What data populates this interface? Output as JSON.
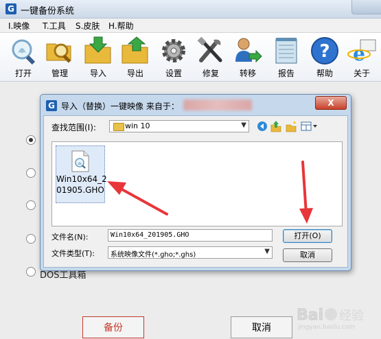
{
  "app": {
    "logo_letter": "G",
    "title": "一键备份系统"
  },
  "menu": [
    {
      "label": "I.映像"
    },
    {
      "label": "T.工具"
    },
    {
      "label": "S.皮肤"
    },
    {
      "label": "H.帮助"
    }
  ],
  "toolbar": [
    {
      "label": "打开",
      "icon": "ghost-magnifier-icon"
    },
    {
      "label": "管理",
      "icon": "folder-magnifier-icon"
    },
    {
      "label": "导入",
      "icon": "folder-import-icon"
    },
    {
      "label": "导出",
      "icon": "folder-export-icon"
    },
    {
      "label": "设置",
      "icon": "gear-icon"
    },
    {
      "label": "修复",
      "icon": "tools-icon"
    },
    {
      "label": "转移",
      "icon": "user-transfer-icon"
    },
    {
      "label": "报告",
      "icon": "notepad-icon"
    },
    {
      "label": "帮助",
      "icon": "help-icon"
    },
    {
      "label": "关于",
      "icon": "ie-icon"
    }
  ],
  "main": {
    "partial_label": "DOS工具箱",
    "backup_button": "备份",
    "cancel_button": "取消"
  },
  "dialog": {
    "logo_letter": "G",
    "title": "导入（替换）一键映像 来自于：",
    "close": "X",
    "look_in_label": "查找范围(I):",
    "look_in_value": "win 10",
    "file": {
      "name": "Win10x64_201905.GHO",
      "name_line1": "Win10x64_2",
      "name_line2": "01905.GHO"
    },
    "file_name_label": "文件名(N):",
    "file_name_value": "Win10x64_201905.GHO",
    "file_type_label": "文件类型(T):",
    "file_type_value": "系统映像文件(*.gho;*.ghs)",
    "open_button": "打开(O)",
    "cancel_button": "取消"
  },
  "watermark": {
    "text": "Bai 经验",
    "sub": "jingyan.baidu.com"
  },
  "colors": {
    "arrow_red": "#e8353a",
    "dialog_frame": "#c6d8ec",
    "backup_red": "#c0392b"
  }
}
